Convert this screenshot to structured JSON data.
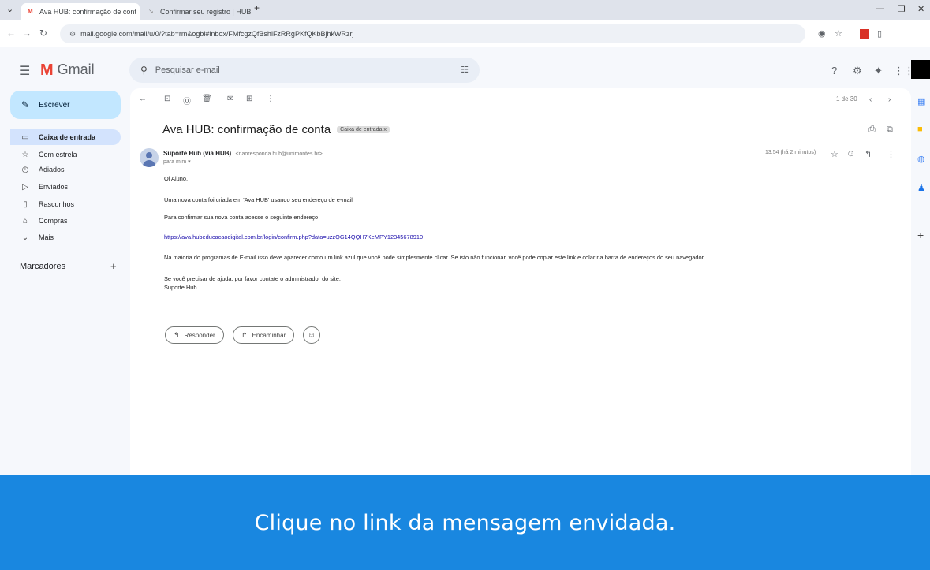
{
  "browser": {
    "tabs": [
      {
        "title": "Ava HUB: confirmação de cont",
        "close": "X"
      },
      {
        "title": "Confirmar seu registro | HUB",
        "close": "X"
      }
    ],
    "new_tab": "+",
    "url": "mail.google.com/mail/u/0/?tab=rm&ogbl#inbox/FMfcgzQfBshlFzRRgPKfQKbBjhkWRzrj"
  },
  "gmail": {
    "app_name": "Gmail",
    "search_placeholder": "Pesquisar e-mail",
    "compose_label": "Escrever",
    "nav": [
      {
        "label": "Caixa de entrada",
        "icon": "inbox-icon",
        "active": true
      },
      {
        "label": "Com estrela",
        "icon": "star-icon"
      },
      {
        "label": "Adiados",
        "icon": "clock-icon"
      },
      {
        "label": "Enviados",
        "icon": "send-icon"
      },
      {
        "label": "Rascunhos",
        "icon": "draft-icon"
      },
      {
        "label": "Compras",
        "icon": "shopping-icon"
      },
      {
        "label": "Mais",
        "icon": "chevron-down-icon"
      }
    ],
    "labels_title": "Marcadores",
    "labels_add": "+",
    "pager": "1 de 30"
  },
  "email": {
    "subject": "Ava HUB: confirmação de conta",
    "label_chip": "Caixa de entrada x",
    "sender_name": "Suporte Hub (via HUB)",
    "sender_email": "<naoresponda.hub@unimontes.br>",
    "to": "para mim ▾",
    "time": "13:54 (há 2 minutos)",
    "greeting": "Oi Aluno,",
    "line1": "Uma nova conta foi criada em 'Ava HUB' usando seu endereço de e-mail",
    "line2": "Para confirmar sua nova conta acesse o seguinte endereço",
    "link": "https://ava.hubeducacaodigital.com.br/login/confirm.php?data=uzzQG14QQH7KeMPY12345678910",
    "line3": "Na maioria do programas de E-mail isso deve aparecer como um link azul que você pode simplesmente clicar. Se isto não funcionar, você pode copiar este link e colar na barra de endereços do seu navegador.",
    "line4": "Se você precisar de ajuda, por favor contate o administrador do site,",
    "signature": "Suporte Hub",
    "reply_label": "Responder",
    "forward_label": "Encaminhar"
  },
  "banner": {
    "text": "Clique no link da mensagem envidada."
  },
  "colors": {
    "banner_bg": "#1987e0",
    "compose_bg": "#c2e7ff",
    "active_nav_bg": "#d3e3fd",
    "link": "#1a0dab"
  }
}
